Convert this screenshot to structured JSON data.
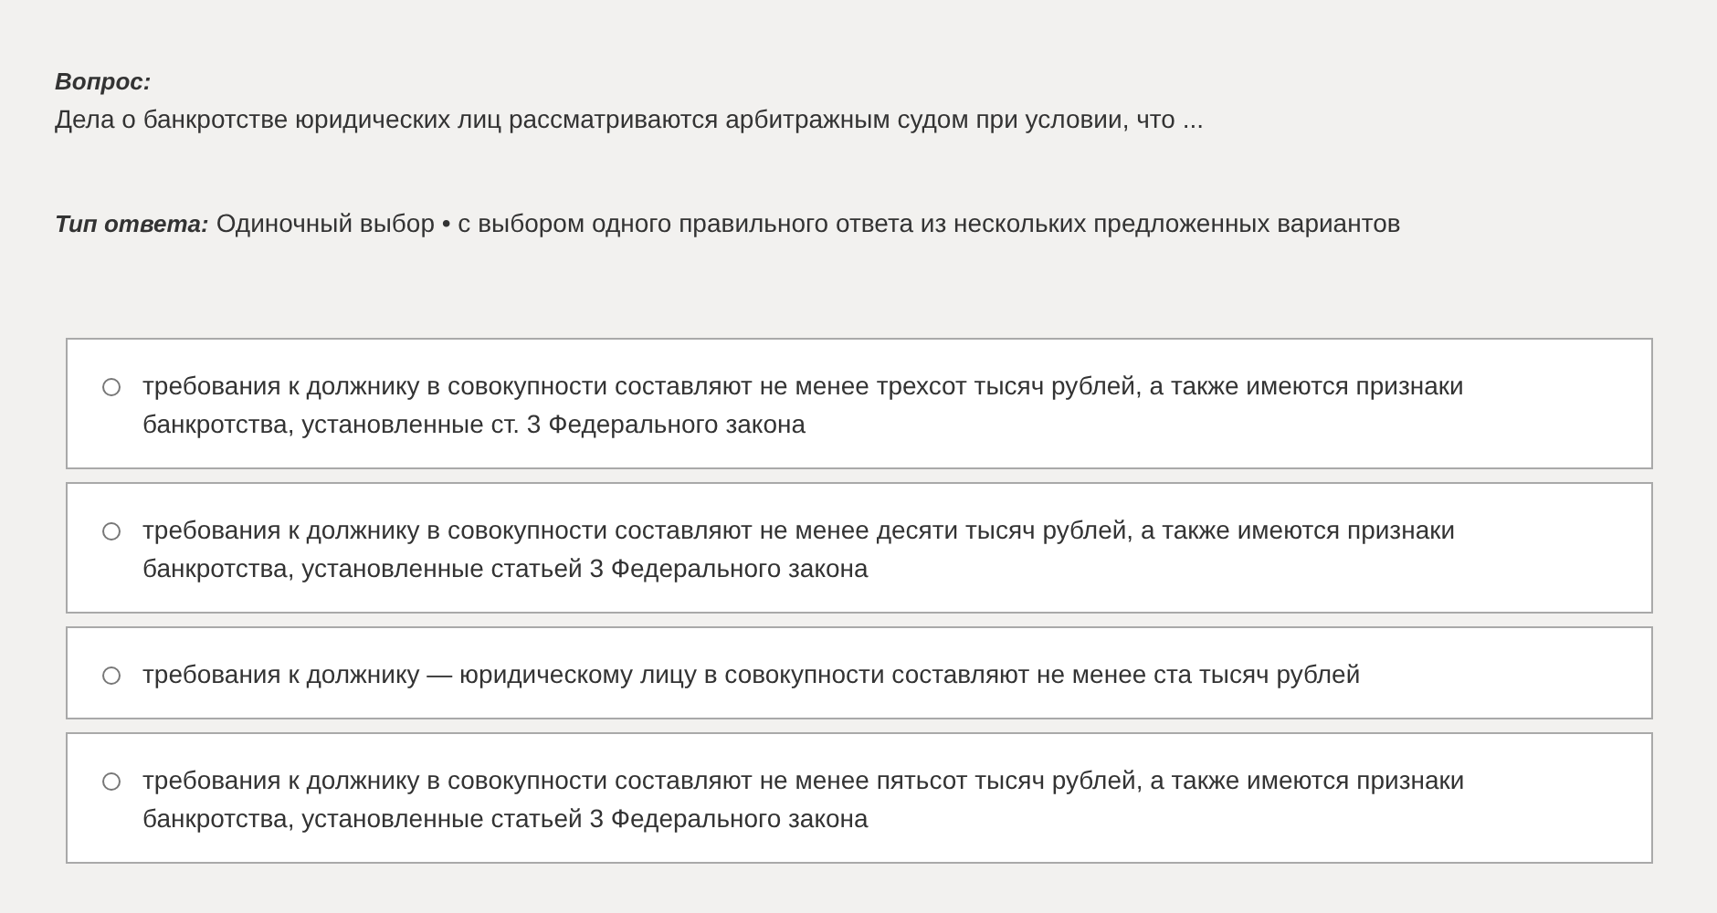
{
  "question": {
    "label": "Вопрос:",
    "text": "Дела о банкротстве юридических лиц рассматриваются арбитражным судом при условии, что ..."
  },
  "answer_type": {
    "label": "Тип ответа:",
    "value": "Одиночный выбор • с выбором одного правильного ответа из нескольких предложенных вариантов"
  },
  "options": [
    {
      "text": "требования к должнику в совокупности составляют не менее трехсот тысяч рублей, а также имеются признаки банкротства, установленные ст. 3 Федерального закона",
      "selected": false
    },
    {
      "text": "требования к должнику в совокупности составляют не менее десяти тысяч рублей, а также имеются признаки банкротства, установленные статьей 3 Федерального закона",
      "selected": false
    },
    {
      "text": "требования к должнику — юридическому лицу в совокупности составляют не менее ста тысяч рублей",
      "selected": false
    },
    {
      "text": "требования к должнику в совокупности составляют не менее пятьсот тысяч рублей, а также имеются признаки банкротства, установленные статьей 3 Федерального закона",
      "selected": false
    }
  ]
}
